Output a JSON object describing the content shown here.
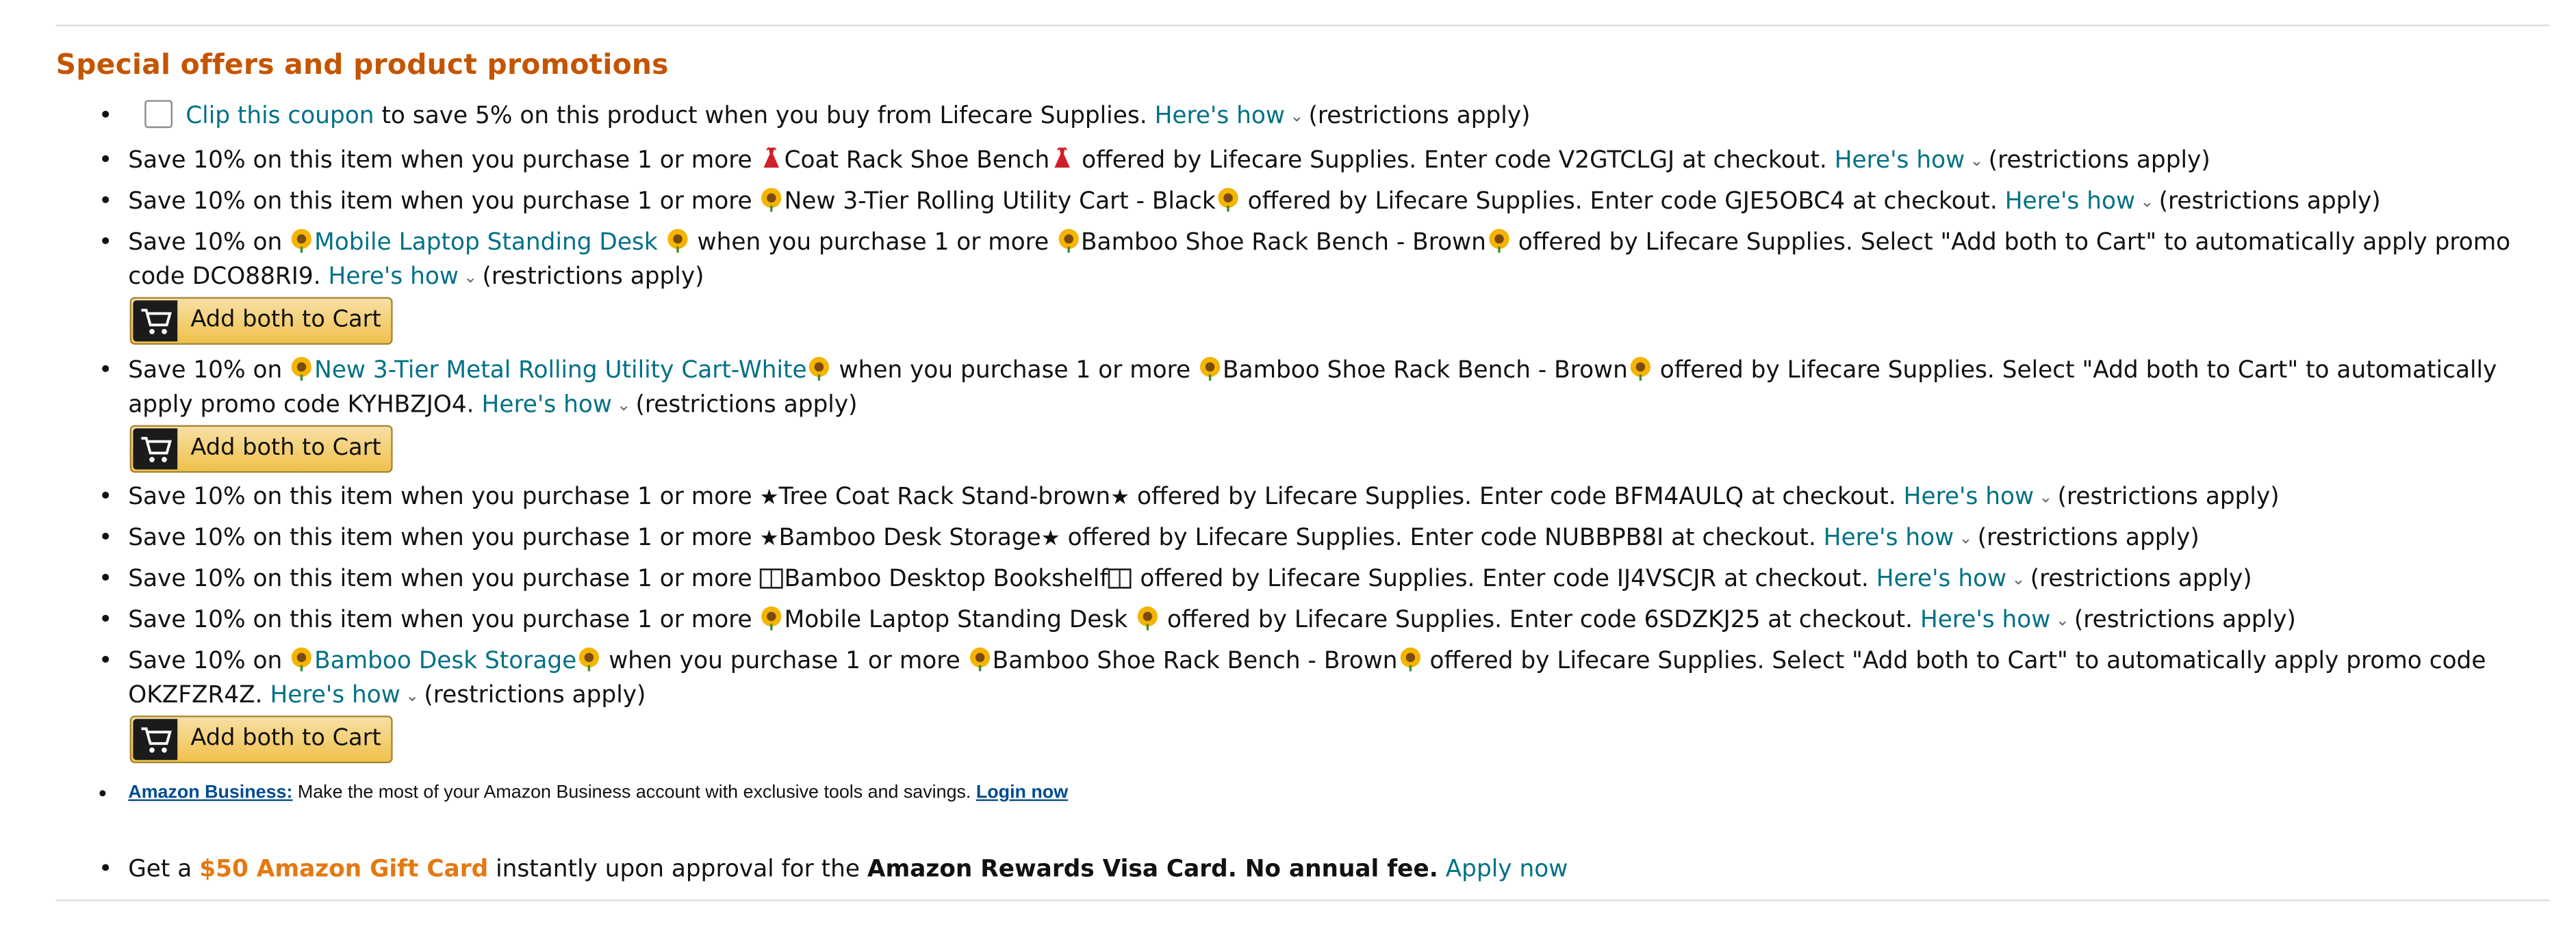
{
  "section_title": "Special offers and product promotions",
  "bullet_char": "•",
  "chevron": "⌄",
  "common": {
    "heres_how": "Here's how",
    "restrictions": "(restrictions apply)",
    "add_both": "Add both to Cart"
  },
  "coupon": {
    "clip_link": "Clip this coupon",
    "text": "to save 5% on this product when you buy from Lifecare Supplies."
  },
  "offers": [
    {
      "prefix": "Save 10% on this item when you purchase 1 or more ",
      "product": "Coat Rack Shoe Bench",
      "icon": "red-dress-icon",
      "suffix": " offered by Lifecare Supplies. Enter code V2GTCLGJ at checkout."
    },
    {
      "prefix": "Save 10% on this item when you purchase 1 or more ",
      "product": "New 3-Tier Rolling Utility Cart - Black",
      "icon": "sunflower-icon",
      "suffix": " offered by Lifecare Supplies. Enter code GJE5OBC4 at checkout."
    }
  ],
  "bundles": [
    {
      "save": "Save 10% on ",
      "link": "Mobile Laptop Standing Desk",
      "mid": " when you purchase 1 or more ",
      "product": "Bamboo Shoe Rack Bench - Brown",
      "tail": " offered by Lifecare Supplies. Select \"Add both to Cart\" to automatically apply promo code DCO88RI9."
    },
    {
      "save": "Save 10% on ",
      "link": "New 3-Tier Metal Rolling Utility Cart-White",
      "mid": " when you purchase 1 or more ",
      "product": "Bamboo Shoe Rack Bench - Brown",
      "tail": " offered by Lifecare Supplies. Select \"Add both to Cart\" to automatically apply promo code KYHBZJO4."
    }
  ],
  "offers2": [
    {
      "prefix": "Save 10% on this item when you purchase 1 or more ",
      "product": "Tree Coat Rack Stand-brown",
      "suffix": " offered by Lifecare Supplies. Enter code BFM4AULQ at checkout."
    },
    {
      "prefix": "Save 10% on this item when you purchase 1 or more ",
      "product": "Bamboo Desk Storage",
      "suffix": " offered by Lifecare Supplies. Enter code NUBBPB8I at checkout."
    },
    {
      "prefix": "Save 10% on this item when you purchase 1 or more ",
      "product": "Bamboo Desktop Bookshelf",
      "suffix": " offered by Lifecare Supplies. Enter code IJ4VSCJR at checkout."
    },
    {
      "prefix": "Save 10% on this item when you purchase 1 or more ",
      "product": "Mobile Laptop Standing Desk",
      "suffix": " offered by Lifecare Supplies. Enter code 6SDZKJ25 at checkout."
    }
  ],
  "bundle3": {
    "save": "Save 10% on ",
    "link": "Bamboo Desk Storage",
    "mid": " when you purchase 1 or more ",
    "product": "Bamboo Shoe Rack Bench - Brown",
    "tail": " offered by Lifecare Supplies. Select \"Add both to Cart\" to automatically apply promo code OKZFZR4Z."
  },
  "business": {
    "label": "Amazon Business:",
    "text": " Make the most of your Amazon Business account with exclusive tools and savings. ",
    "login": "Login now"
  },
  "visa": {
    "get_a": "Get a ",
    "gift": "$50 Amazon Gift Card",
    "mid": " instantly upon approval for the ",
    "card": "Amazon Rewards Visa Card. No annual fee.",
    "apply": "Apply now"
  },
  "colors": {
    "title": "#c45500",
    "link": "#007185",
    "button_top": "#f7dfa5",
    "button_bottom": "#f0c14b",
    "gift": "#e47911",
    "business_link": "#004b91"
  }
}
